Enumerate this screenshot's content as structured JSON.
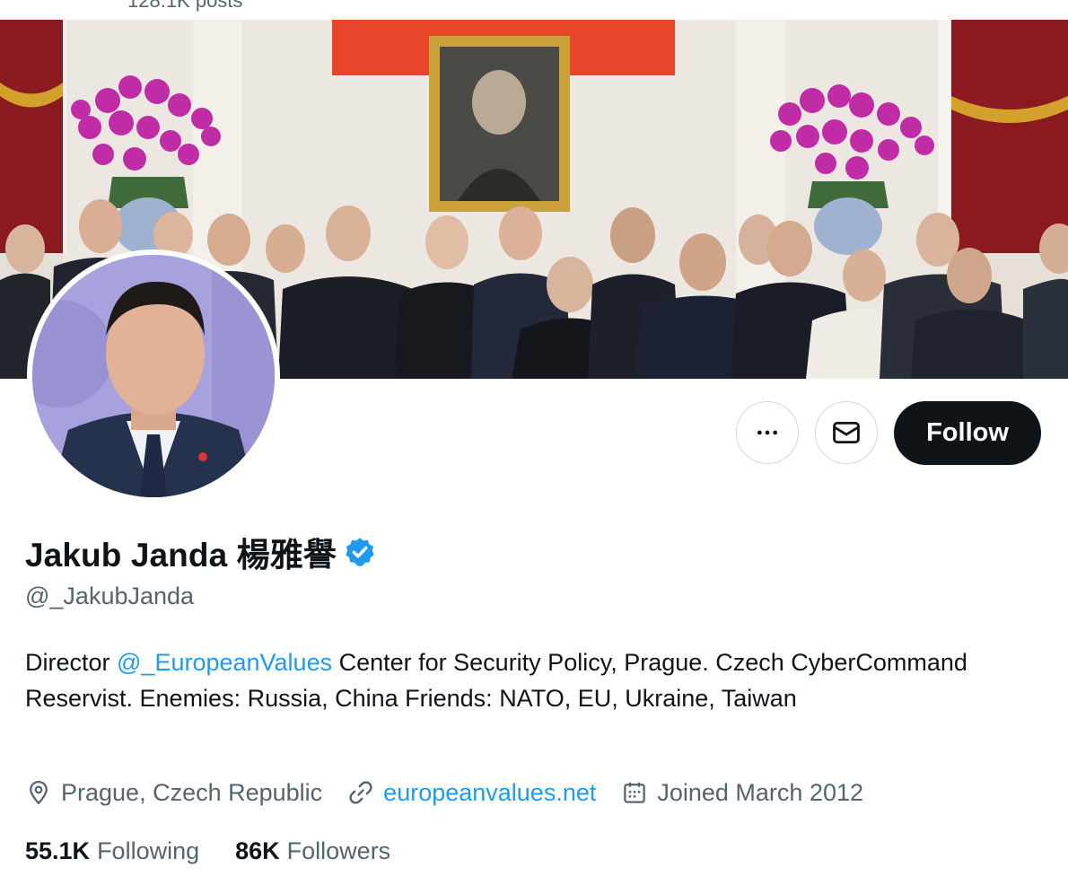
{
  "header": {
    "post_count": "128.1K posts"
  },
  "banner": {
    "description_icon": "group-photo-banner"
  },
  "profile": {
    "display_name": "Jakub Janda 楊雅譽",
    "verified": true,
    "handle": "@_JakubJanda",
    "bio": {
      "prefix": "Director ",
      "mention": "@_EuropeanValues",
      "suffix": " Center for Security Policy, Prague. Czech CyberCommand Reservist. Enemies: Russia, China Friends: NATO, EU, Ukraine, Taiwan"
    },
    "location": "Prague, Czech Republic",
    "website": "europeanvalues.net",
    "joined": "Joined March 2012"
  },
  "actions": {
    "more_icon": "more-icon",
    "message_icon": "envelope-icon",
    "follow_label": "Follow"
  },
  "stats": {
    "following_count": "55.1K",
    "following_label": "Following",
    "followers_count": "86K",
    "followers_label": "Followers"
  },
  "colors": {
    "accent": "#1d9bf0",
    "text_primary": "#0f1419",
    "text_secondary": "#536471",
    "follow_bg": "#0f1419",
    "border": "#cfd9de"
  }
}
